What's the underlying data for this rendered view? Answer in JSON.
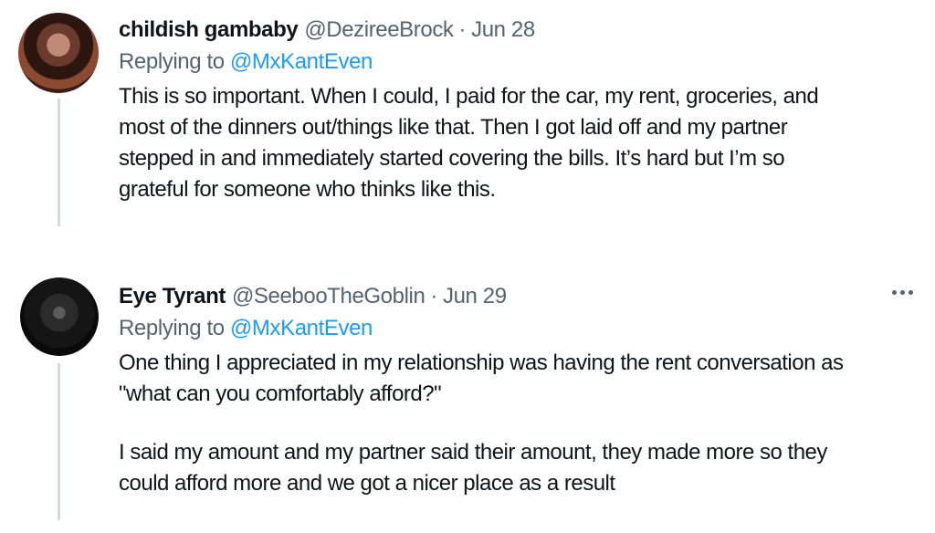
{
  "tweets": [
    {
      "display_name": "childish gambaby",
      "handle": "@DezireeBrock",
      "separator": "·",
      "date": "Jun 28",
      "replying_prefix": "Replying to",
      "replying_handle": "@MxKantEven",
      "lines": [
        "This is so important. When I could, I paid for the car, my rent, groceries, and",
        "most of the dinners out/things like that. Then I got laid off and my partner",
        "stepped in and immediately started covering the bills. It’s hard but I’m so",
        "grateful for someone who thinks like this."
      ]
    },
    {
      "display_name": "Eye Tyrant",
      "handle": "@SeebooTheGoblin",
      "separator": "·",
      "date": "Jun 29",
      "replying_prefix": "Replying to",
      "replying_handle": "@MxKantEven",
      "lines": [
        "One thing I appreciated in my relationship was having the rent conversation as",
        "\"what can you comfortably afford?\"",
        "I said my amount and my partner said their amount, they made more so they",
        "could afford more and we got a nicer place as a result"
      ]
    }
  ],
  "icons": {
    "more": "more-horizontal-icon"
  }
}
